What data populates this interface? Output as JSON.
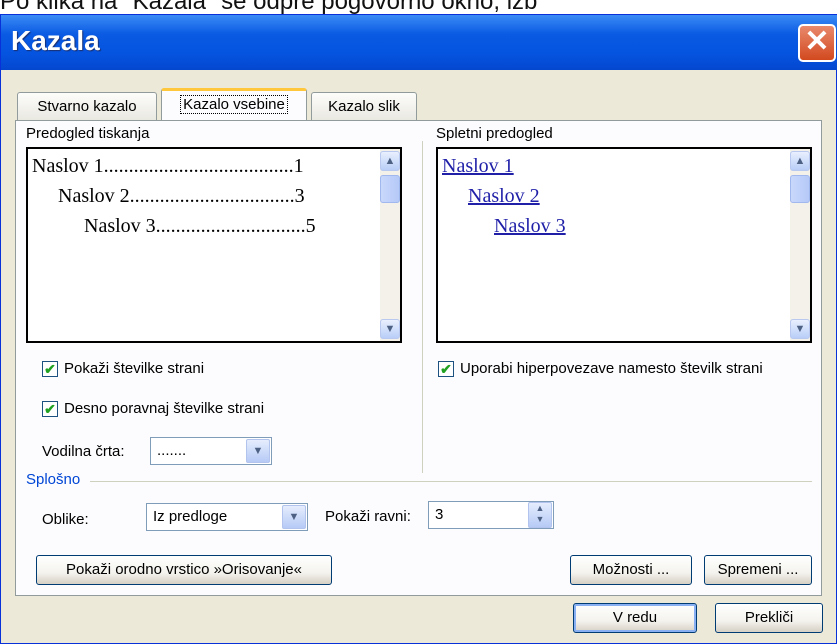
{
  "background_text": "Po klika na \"Kazala\" se odpre pogovorno okno, izb",
  "dialog": {
    "title": "Kazala",
    "close_glyph": "✕"
  },
  "tabs": [
    {
      "label": "Stvarno kazalo",
      "active": false
    },
    {
      "label": "Kazalo vsebine",
      "active": true
    },
    {
      "label": "Kazalo slik",
      "active": false
    }
  ],
  "print_preview": {
    "label": "Predogled tiskanja",
    "entries": [
      {
        "text": "Naslov 1",
        "dots": "......................................",
        "page": "1"
      },
      {
        "text": "Naslov 2",
        "dots": ".................................",
        "page": "3"
      },
      {
        "text": "Naslov 3",
        "dots": "..............................",
        "page": "5"
      }
    ]
  },
  "web_preview": {
    "label": "Spletni predogled",
    "links": [
      "Naslov 1",
      "Naslov 2",
      "Naslov 3"
    ]
  },
  "options": {
    "show_page_numbers": {
      "label": "Pokaži številke strani",
      "checked": true
    },
    "right_align": {
      "label": "Desno poravnaj številke strani",
      "checked": true
    },
    "use_hyperlinks": {
      "label": "Uporabi hiperpovezave namesto številk strani",
      "checked": true
    },
    "tab_leader_label": "Vodilna črta:",
    "tab_leader_value": ".......",
    "check_glyph": "✔"
  },
  "general": {
    "label": "Splošno",
    "formats_label": "Oblike:",
    "formats_value": "Iz predloge",
    "levels_label": "Pokaži ravni:",
    "levels_value": "3"
  },
  "buttons": {
    "outline_toolbar": "Pokaži orodno vrstico »Orisovanje«",
    "options": "Možnosti ...",
    "modify": "Spremeni ...",
    "ok": "V redu",
    "cancel": "Prekliči"
  },
  "icons": {
    "scroll_up": "▲",
    "scroll_down": "▼",
    "dropdown": "▼",
    "spin_up": "▲",
    "spin_down": "▼"
  },
  "colors": {
    "title_bar": "#0554e0",
    "dialog_bg": "#ece9d8",
    "link": "#1f1fa8",
    "active_tab_accent": "#ffc73c"
  }
}
